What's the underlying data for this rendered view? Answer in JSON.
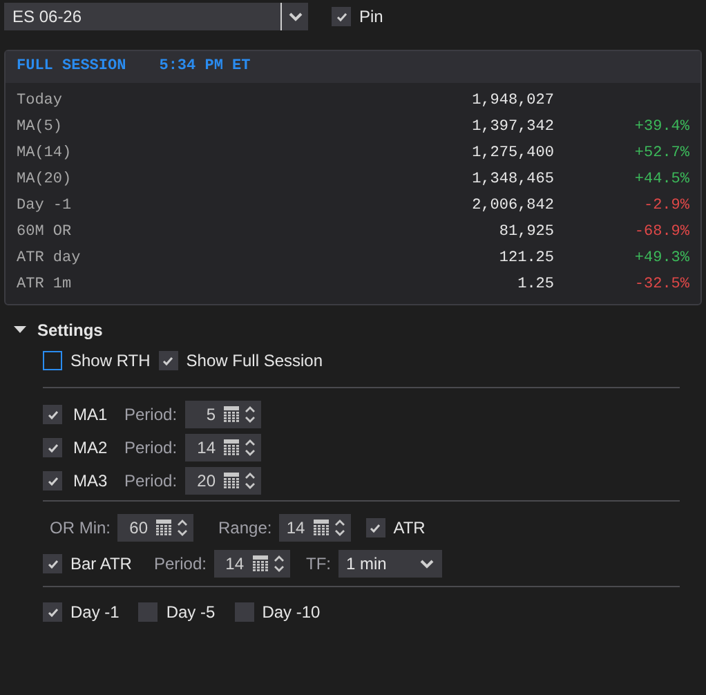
{
  "instrument": {
    "value": "ES 06-26"
  },
  "pin": {
    "label": "Pin",
    "checked": true
  },
  "panel": {
    "title": "FULL SESSION",
    "time": "5:34 PM ET",
    "rows": [
      {
        "label": "Today",
        "value": "1,948,027"
      },
      {
        "label": "MA(5)",
        "value": "1,397,342",
        "change": "+39.4%",
        "color": "#3cb95a"
      },
      {
        "label": "MA(14)",
        "value": "1,275,400",
        "change": "+52.7%",
        "color": "#3cb95a"
      },
      {
        "label": "MA(20)",
        "value": "1,348,465",
        "change": "+44.5%",
        "color": "#3cb95a"
      },
      {
        "label": "Day -1",
        "value": "2,006,842",
        "change": "-2.9%",
        "color": "#e04848"
      },
      {
        "label": "60M OR",
        "value": "81,925",
        "change": "-68.9%",
        "color": "#e04848"
      },
      {
        "label": "ATR day",
        "value": "121.25",
        "change": "+49.3%",
        "color": "#3cb95a"
      },
      {
        "label": "ATR 1m",
        "value": "1.25",
        "change": "-32.5%",
        "color": "#e04848"
      }
    ]
  },
  "settings": {
    "title": "Settings",
    "expanded": true,
    "session_options": [
      {
        "label": "Show RTH",
        "checked": false,
        "focused": true
      },
      {
        "label": "Show Full Session",
        "checked": true
      }
    ],
    "ma_rows": [
      {
        "label": "MA1",
        "checked": true,
        "period_label": "Period:",
        "period": "5"
      },
      {
        "label": "MA2",
        "checked": true,
        "period_label": "Period:",
        "period": "14"
      },
      {
        "label": "MA3",
        "checked": true,
        "period_label": "Period:",
        "period": "20"
      }
    ],
    "or_row": {
      "or_min_label": "OR Min:",
      "or_min": "60",
      "range_label": "Range:",
      "range": "14",
      "atr": {
        "label": "ATR",
        "checked": true
      }
    },
    "bar_atr": {
      "label": "Bar ATR",
      "checked": true,
      "period_label": "Period:",
      "period": "14",
      "tf_label": "TF:",
      "tf": "1 min"
    },
    "days": [
      {
        "label": "Day -1",
        "checked": true
      },
      {
        "label": "Day -5",
        "checked": false
      },
      {
        "label": "Day -10",
        "checked": false
      }
    ]
  }
}
